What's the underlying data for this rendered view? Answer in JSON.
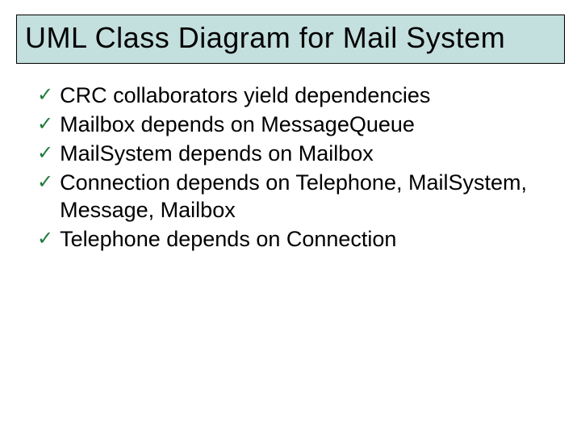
{
  "title": "UML Class Diagram for Mail System",
  "bullets": [
    "CRC collaborators yield dependencies",
    "Mailbox depends on MessageQueue",
    "MailSystem depends on Mailbox",
    "Connection depends on Telephone, MailSystem, Message, Mailbox",
    "Telephone depends on Connection"
  ]
}
